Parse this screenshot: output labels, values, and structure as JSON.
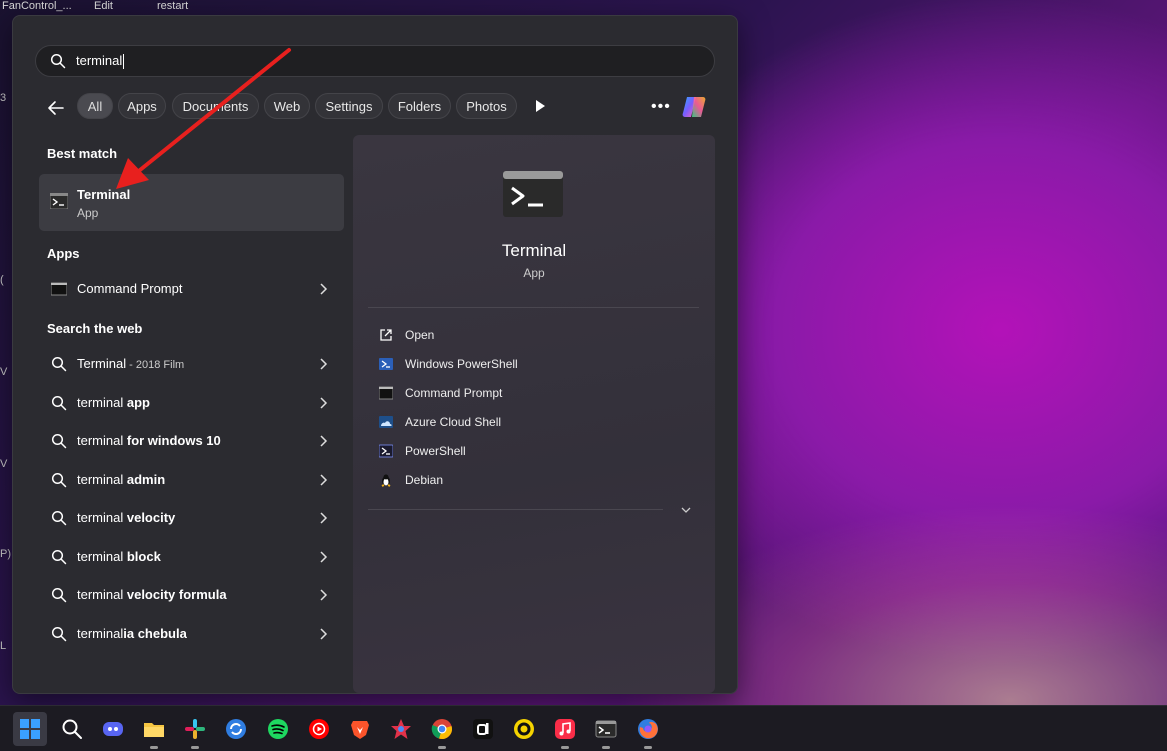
{
  "desktop": {
    "top_labels": [
      "FanControl_...",
      "Edit",
      "restart"
    ],
    "edge_letters": [
      "3",
      "(",
      "V",
      "V",
      "P)",
      "L"
    ]
  },
  "search": {
    "query": "terminal",
    "icon": "search-icon"
  },
  "filters": {
    "back": "back-arrow-icon",
    "chips": [
      "All",
      "Apps",
      "Documents",
      "Web",
      "Settings",
      "Folders",
      "Photos"
    ],
    "active": "All",
    "more": "•••"
  },
  "best_match": {
    "heading": "Best match",
    "name": "Terminal",
    "type": "App"
  },
  "apps": {
    "heading": "Apps",
    "items": [
      {
        "label": "Command Prompt",
        "icon": "command-prompt-icon"
      }
    ]
  },
  "web": {
    "heading": "Search the web",
    "items": [
      {
        "prefix": "Terminal",
        "bold": "",
        "sub": " - 2018 Film"
      },
      {
        "prefix": "terminal ",
        "bold": "app",
        "sub": ""
      },
      {
        "prefix": "terminal ",
        "bold": "for windows 10",
        "sub": ""
      },
      {
        "prefix": "terminal ",
        "bold": "admin",
        "sub": ""
      },
      {
        "prefix": "terminal ",
        "bold": "velocity",
        "sub": ""
      },
      {
        "prefix": "terminal ",
        "bold": "block",
        "sub": ""
      },
      {
        "prefix": "terminal ",
        "bold": "velocity formula",
        "sub": ""
      },
      {
        "prefix": "terminal",
        "bold": "ia chebula",
        "sub": ""
      }
    ]
  },
  "preview": {
    "name": "Terminal",
    "type": "App",
    "actions": [
      {
        "label": "Open",
        "icon": "open-external-icon"
      },
      {
        "label": "Windows PowerShell",
        "icon": "powershell-icon"
      },
      {
        "label": "Command Prompt",
        "icon": "command-prompt-icon"
      },
      {
        "label": "Azure Cloud Shell",
        "icon": "azure-cloud-icon"
      },
      {
        "label": "PowerShell",
        "icon": "powershell-icon"
      },
      {
        "label": "Debian",
        "icon": "linux-penguin-icon"
      }
    ]
  },
  "taskbar": {
    "items": [
      "start",
      "search",
      "discord",
      "file-explorer",
      "slack",
      "sync",
      "spotify",
      "youtube-music",
      "brave",
      "app-star",
      "chrome",
      "app-a",
      "app-ring",
      "apple-music",
      "terminal",
      "firefox-dev"
    ]
  },
  "colors": {
    "accent_red": "#e8201e",
    "panel": "#2b2b30",
    "highlight": "#3c3c42"
  }
}
